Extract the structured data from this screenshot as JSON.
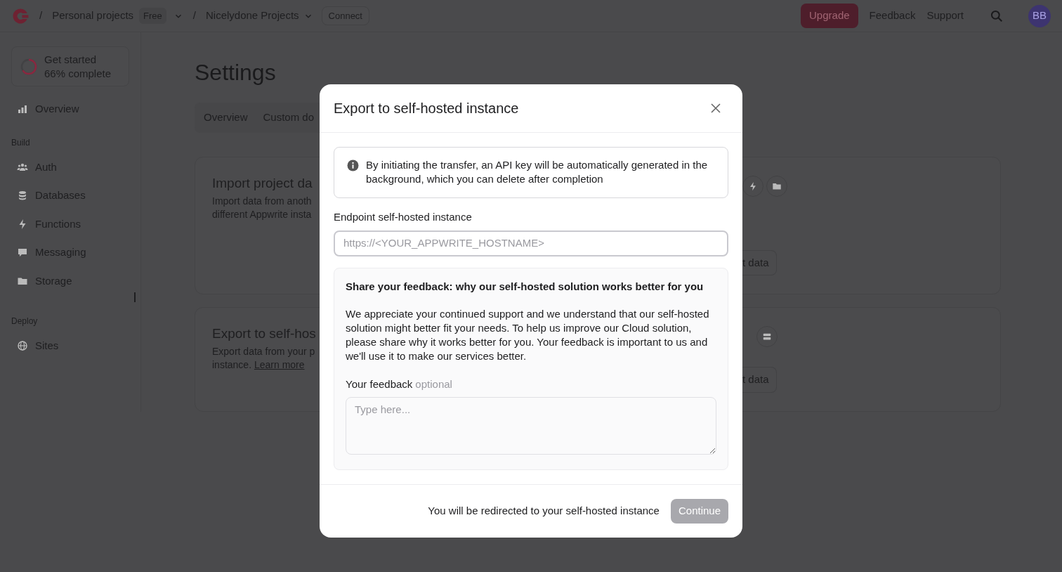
{
  "topbar": {
    "separators": [
      "/",
      "/"
    ],
    "organization": "Personal projects",
    "plan_badge": "Free",
    "project": "Nicelydone Projects",
    "connect_button": "Connect",
    "upgrade_button": "Upgrade",
    "links": [
      "Feedback",
      "Support"
    ],
    "avatar": "BB"
  },
  "sidebar": {
    "progress": {
      "title": "Get started",
      "subtitle": "66% complete"
    },
    "top_items": [
      {
        "label": "Overview"
      }
    ],
    "sections": [
      {
        "heading": "Build",
        "items": [
          {
            "label": "Auth"
          },
          {
            "label": "Databases"
          },
          {
            "label": "Functions"
          },
          {
            "label": "Messaging"
          },
          {
            "label": "Storage"
          }
        ]
      },
      {
        "heading": "Deploy",
        "items": [
          {
            "label": "Sites"
          }
        ]
      }
    ]
  },
  "main": {
    "title": "Settings",
    "tabs": [
      {
        "label": "Overview",
        "selected": false
      },
      {
        "label": "Custom do",
        "selected": false
      }
    ],
    "cards": [
      {
        "title": "Import project da",
        "description_lines": [
          "Import data from anoth",
          "different Appwrite insta"
        ],
        "button": "t data"
      },
      {
        "title": "Export to self-hos",
        "description_lines": [
          "Export data from your p",
          "instance."
        ],
        "link": "Learn more",
        "button": "t data"
      }
    ]
  },
  "modal": {
    "title": "Export to self-hosted instance",
    "alert": "By initiating the transfer, an API key will be automatically generated in the background, which you can delete after completion",
    "endpoint": {
      "label": "Endpoint self-hosted instance",
      "placeholder": "https://<YOUR_APPWRITE_HOSTNAME>"
    },
    "feedback": {
      "heading": "Share your feedback: why our self-hosted solution works better for you",
      "body": "We appreciate your continued support and we understand that our self-hosted solution might better fit your needs. To help us improve our Cloud solution, please share why it works better for you. Your feedback is important to us and we'll use it to make our services better.",
      "label": "Your feedback",
      "optional": "optional",
      "placeholder": "Type here..."
    },
    "footer_note": "You will be redirected to your self-hosted instance",
    "continue_button": {
      "label": "Continue",
      "disabled": true
    }
  }
}
